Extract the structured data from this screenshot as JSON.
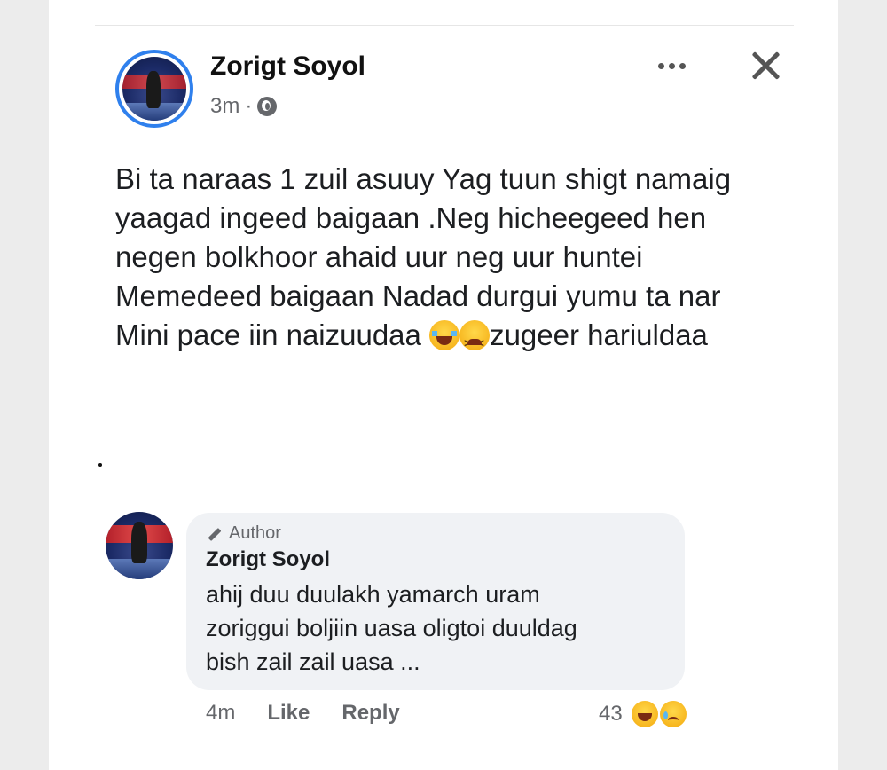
{
  "post": {
    "author": "Zorigt Soyol",
    "time": "3m",
    "separator": "·",
    "text_lines": [
      "Bi ta naraas 1 zuil asuuy Yag tuun shigt namaig",
      "yaagad ingeed baigaan .Neg hicheegeed hen",
      "negen bolkhoor ahaid uur neg uur huntei",
      "Memedeed baigaan Nadad durgui yumu ta nar",
      "Mini pace iin naizuudaa"
    ],
    "last_line_tail": "zugeer hariuldaa",
    "trailing_dot": "."
  },
  "comment": {
    "badge": "Author",
    "author": "Zorigt Soyol",
    "text_lines": [
      "ahij duu duulakh yamarch uram",
      "zoriggui  boljiin uasa oligtoi duuldag",
      "bish zail zail uasa ..."
    ],
    "time": "4m",
    "like_label": "Like",
    "reply_label": "Reply",
    "reaction_count": "43"
  }
}
